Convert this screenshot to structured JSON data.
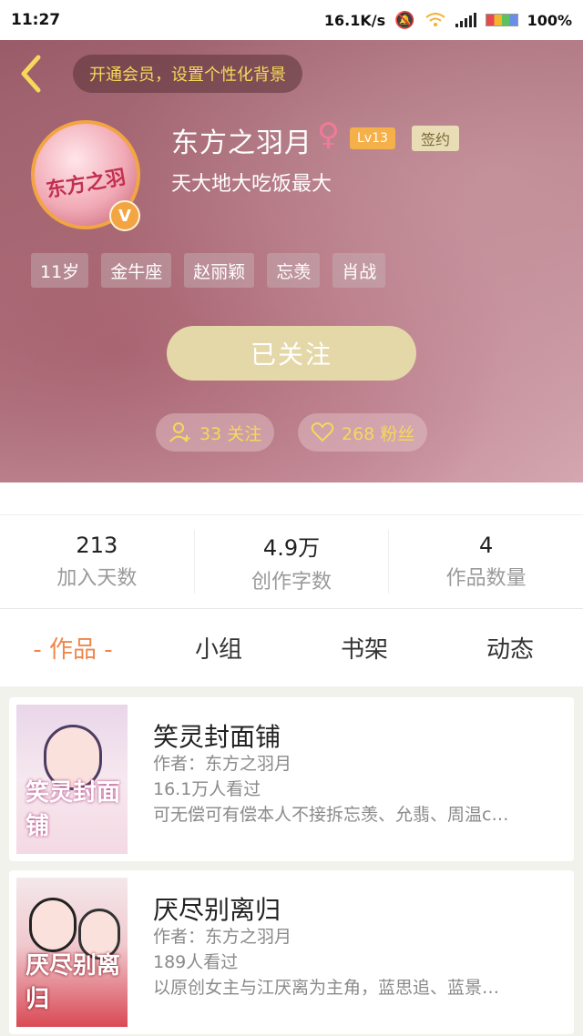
{
  "status_bar": {
    "time": "11:27",
    "speed": "16.1K/s",
    "battery": "100%"
  },
  "header": {
    "vip_prompt": "开通会员，设置个性化背景",
    "username": "东方之羽月",
    "gender_symbol": "♀",
    "level": "Lv13",
    "signed_badge": "签约",
    "motto": "天大地大吃饭最大",
    "avatar_text": "东方之羽",
    "verified_badge": "V",
    "tags": [
      "11岁",
      "金牛座",
      "赵丽颖",
      "忘羡",
      "肖战"
    ],
    "follow_button": "已关注",
    "following_count": "33 关注",
    "fans_count": "268 粉丝"
  },
  "stats": [
    {
      "value": "213",
      "label": "加入天数"
    },
    {
      "value": "4.9万",
      "label": "创作字数"
    },
    {
      "value": "4",
      "label": "作品数量"
    }
  ],
  "tabs": [
    "- 作品 -",
    "小组",
    "书架",
    "动态"
  ],
  "works": [
    {
      "title": "笑灵封面铺",
      "author": "作者：东方之羽月",
      "views": "16.1万人看过",
      "description": "可无偿可有偿本人不接拆忘羡、允翡、周温c…",
      "cover_text": "笑灵封面铺"
    },
    {
      "title": "厌尽别离归",
      "author": "作者：东方之羽月",
      "views": "189人看过",
      "description": "以原创女主与江厌离为主角，蓝思追、蓝景…",
      "cover_text": "厌尽别离归"
    }
  ],
  "colors": {
    "accent": "#f0864a",
    "gold": "#f6d85a",
    "follow_button": "#e4d7a8"
  }
}
